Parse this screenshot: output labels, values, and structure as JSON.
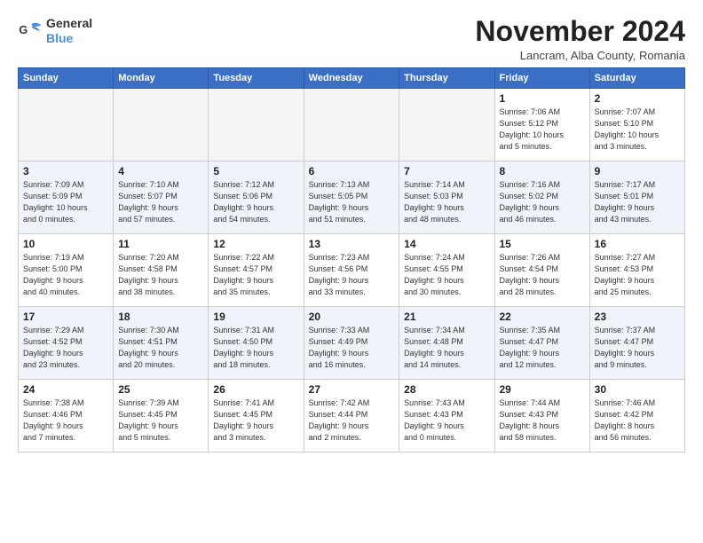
{
  "logo": {
    "line1": "General",
    "line2": "Blue"
  },
  "title": "November 2024",
  "location": "Lancram, Alba County, Romania",
  "days_of_week": [
    "Sunday",
    "Monday",
    "Tuesday",
    "Wednesday",
    "Thursday",
    "Friday",
    "Saturday"
  ],
  "weeks": [
    [
      {
        "day": "",
        "info": ""
      },
      {
        "day": "",
        "info": ""
      },
      {
        "day": "",
        "info": ""
      },
      {
        "day": "",
        "info": ""
      },
      {
        "day": "",
        "info": ""
      },
      {
        "day": "1",
        "info": "Sunrise: 7:06 AM\nSunset: 5:12 PM\nDaylight: 10 hours\nand 5 minutes."
      },
      {
        "day": "2",
        "info": "Sunrise: 7:07 AM\nSunset: 5:10 PM\nDaylight: 10 hours\nand 3 minutes."
      }
    ],
    [
      {
        "day": "3",
        "info": "Sunrise: 7:09 AM\nSunset: 5:09 PM\nDaylight: 10 hours\nand 0 minutes."
      },
      {
        "day": "4",
        "info": "Sunrise: 7:10 AM\nSunset: 5:07 PM\nDaylight: 9 hours\nand 57 minutes."
      },
      {
        "day": "5",
        "info": "Sunrise: 7:12 AM\nSunset: 5:06 PM\nDaylight: 9 hours\nand 54 minutes."
      },
      {
        "day": "6",
        "info": "Sunrise: 7:13 AM\nSunset: 5:05 PM\nDaylight: 9 hours\nand 51 minutes."
      },
      {
        "day": "7",
        "info": "Sunrise: 7:14 AM\nSunset: 5:03 PM\nDaylight: 9 hours\nand 48 minutes."
      },
      {
        "day": "8",
        "info": "Sunrise: 7:16 AM\nSunset: 5:02 PM\nDaylight: 9 hours\nand 46 minutes."
      },
      {
        "day": "9",
        "info": "Sunrise: 7:17 AM\nSunset: 5:01 PM\nDaylight: 9 hours\nand 43 minutes."
      }
    ],
    [
      {
        "day": "10",
        "info": "Sunrise: 7:19 AM\nSunset: 5:00 PM\nDaylight: 9 hours\nand 40 minutes."
      },
      {
        "day": "11",
        "info": "Sunrise: 7:20 AM\nSunset: 4:58 PM\nDaylight: 9 hours\nand 38 minutes."
      },
      {
        "day": "12",
        "info": "Sunrise: 7:22 AM\nSunset: 4:57 PM\nDaylight: 9 hours\nand 35 minutes."
      },
      {
        "day": "13",
        "info": "Sunrise: 7:23 AM\nSunset: 4:56 PM\nDaylight: 9 hours\nand 33 minutes."
      },
      {
        "day": "14",
        "info": "Sunrise: 7:24 AM\nSunset: 4:55 PM\nDaylight: 9 hours\nand 30 minutes."
      },
      {
        "day": "15",
        "info": "Sunrise: 7:26 AM\nSunset: 4:54 PM\nDaylight: 9 hours\nand 28 minutes."
      },
      {
        "day": "16",
        "info": "Sunrise: 7:27 AM\nSunset: 4:53 PM\nDaylight: 9 hours\nand 25 minutes."
      }
    ],
    [
      {
        "day": "17",
        "info": "Sunrise: 7:29 AM\nSunset: 4:52 PM\nDaylight: 9 hours\nand 23 minutes."
      },
      {
        "day": "18",
        "info": "Sunrise: 7:30 AM\nSunset: 4:51 PM\nDaylight: 9 hours\nand 20 minutes."
      },
      {
        "day": "19",
        "info": "Sunrise: 7:31 AM\nSunset: 4:50 PM\nDaylight: 9 hours\nand 18 minutes."
      },
      {
        "day": "20",
        "info": "Sunrise: 7:33 AM\nSunset: 4:49 PM\nDaylight: 9 hours\nand 16 minutes."
      },
      {
        "day": "21",
        "info": "Sunrise: 7:34 AM\nSunset: 4:48 PM\nDaylight: 9 hours\nand 14 minutes."
      },
      {
        "day": "22",
        "info": "Sunrise: 7:35 AM\nSunset: 4:47 PM\nDaylight: 9 hours\nand 12 minutes."
      },
      {
        "day": "23",
        "info": "Sunrise: 7:37 AM\nSunset: 4:47 PM\nDaylight: 9 hours\nand 9 minutes."
      }
    ],
    [
      {
        "day": "24",
        "info": "Sunrise: 7:38 AM\nSunset: 4:46 PM\nDaylight: 9 hours\nand 7 minutes."
      },
      {
        "day": "25",
        "info": "Sunrise: 7:39 AM\nSunset: 4:45 PM\nDaylight: 9 hours\nand 5 minutes."
      },
      {
        "day": "26",
        "info": "Sunrise: 7:41 AM\nSunset: 4:45 PM\nDaylight: 9 hours\nand 3 minutes."
      },
      {
        "day": "27",
        "info": "Sunrise: 7:42 AM\nSunset: 4:44 PM\nDaylight: 9 hours\nand 2 minutes."
      },
      {
        "day": "28",
        "info": "Sunrise: 7:43 AM\nSunset: 4:43 PM\nDaylight: 9 hours\nand 0 minutes."
      },
      {
        "day": "29",
        "info": "Sunrise: 7:44 AM\nSunset: 4:43 PM\nDaylight: 8 hours\nand 58 minutes."
      },
      {
        "day": "30",
        "info": "Sunrise: 7:46 AM\nSunset: 4:42 PM\nDaylight: 8 hours\nand 56 minutes."
      }
    ]
  ]
}
